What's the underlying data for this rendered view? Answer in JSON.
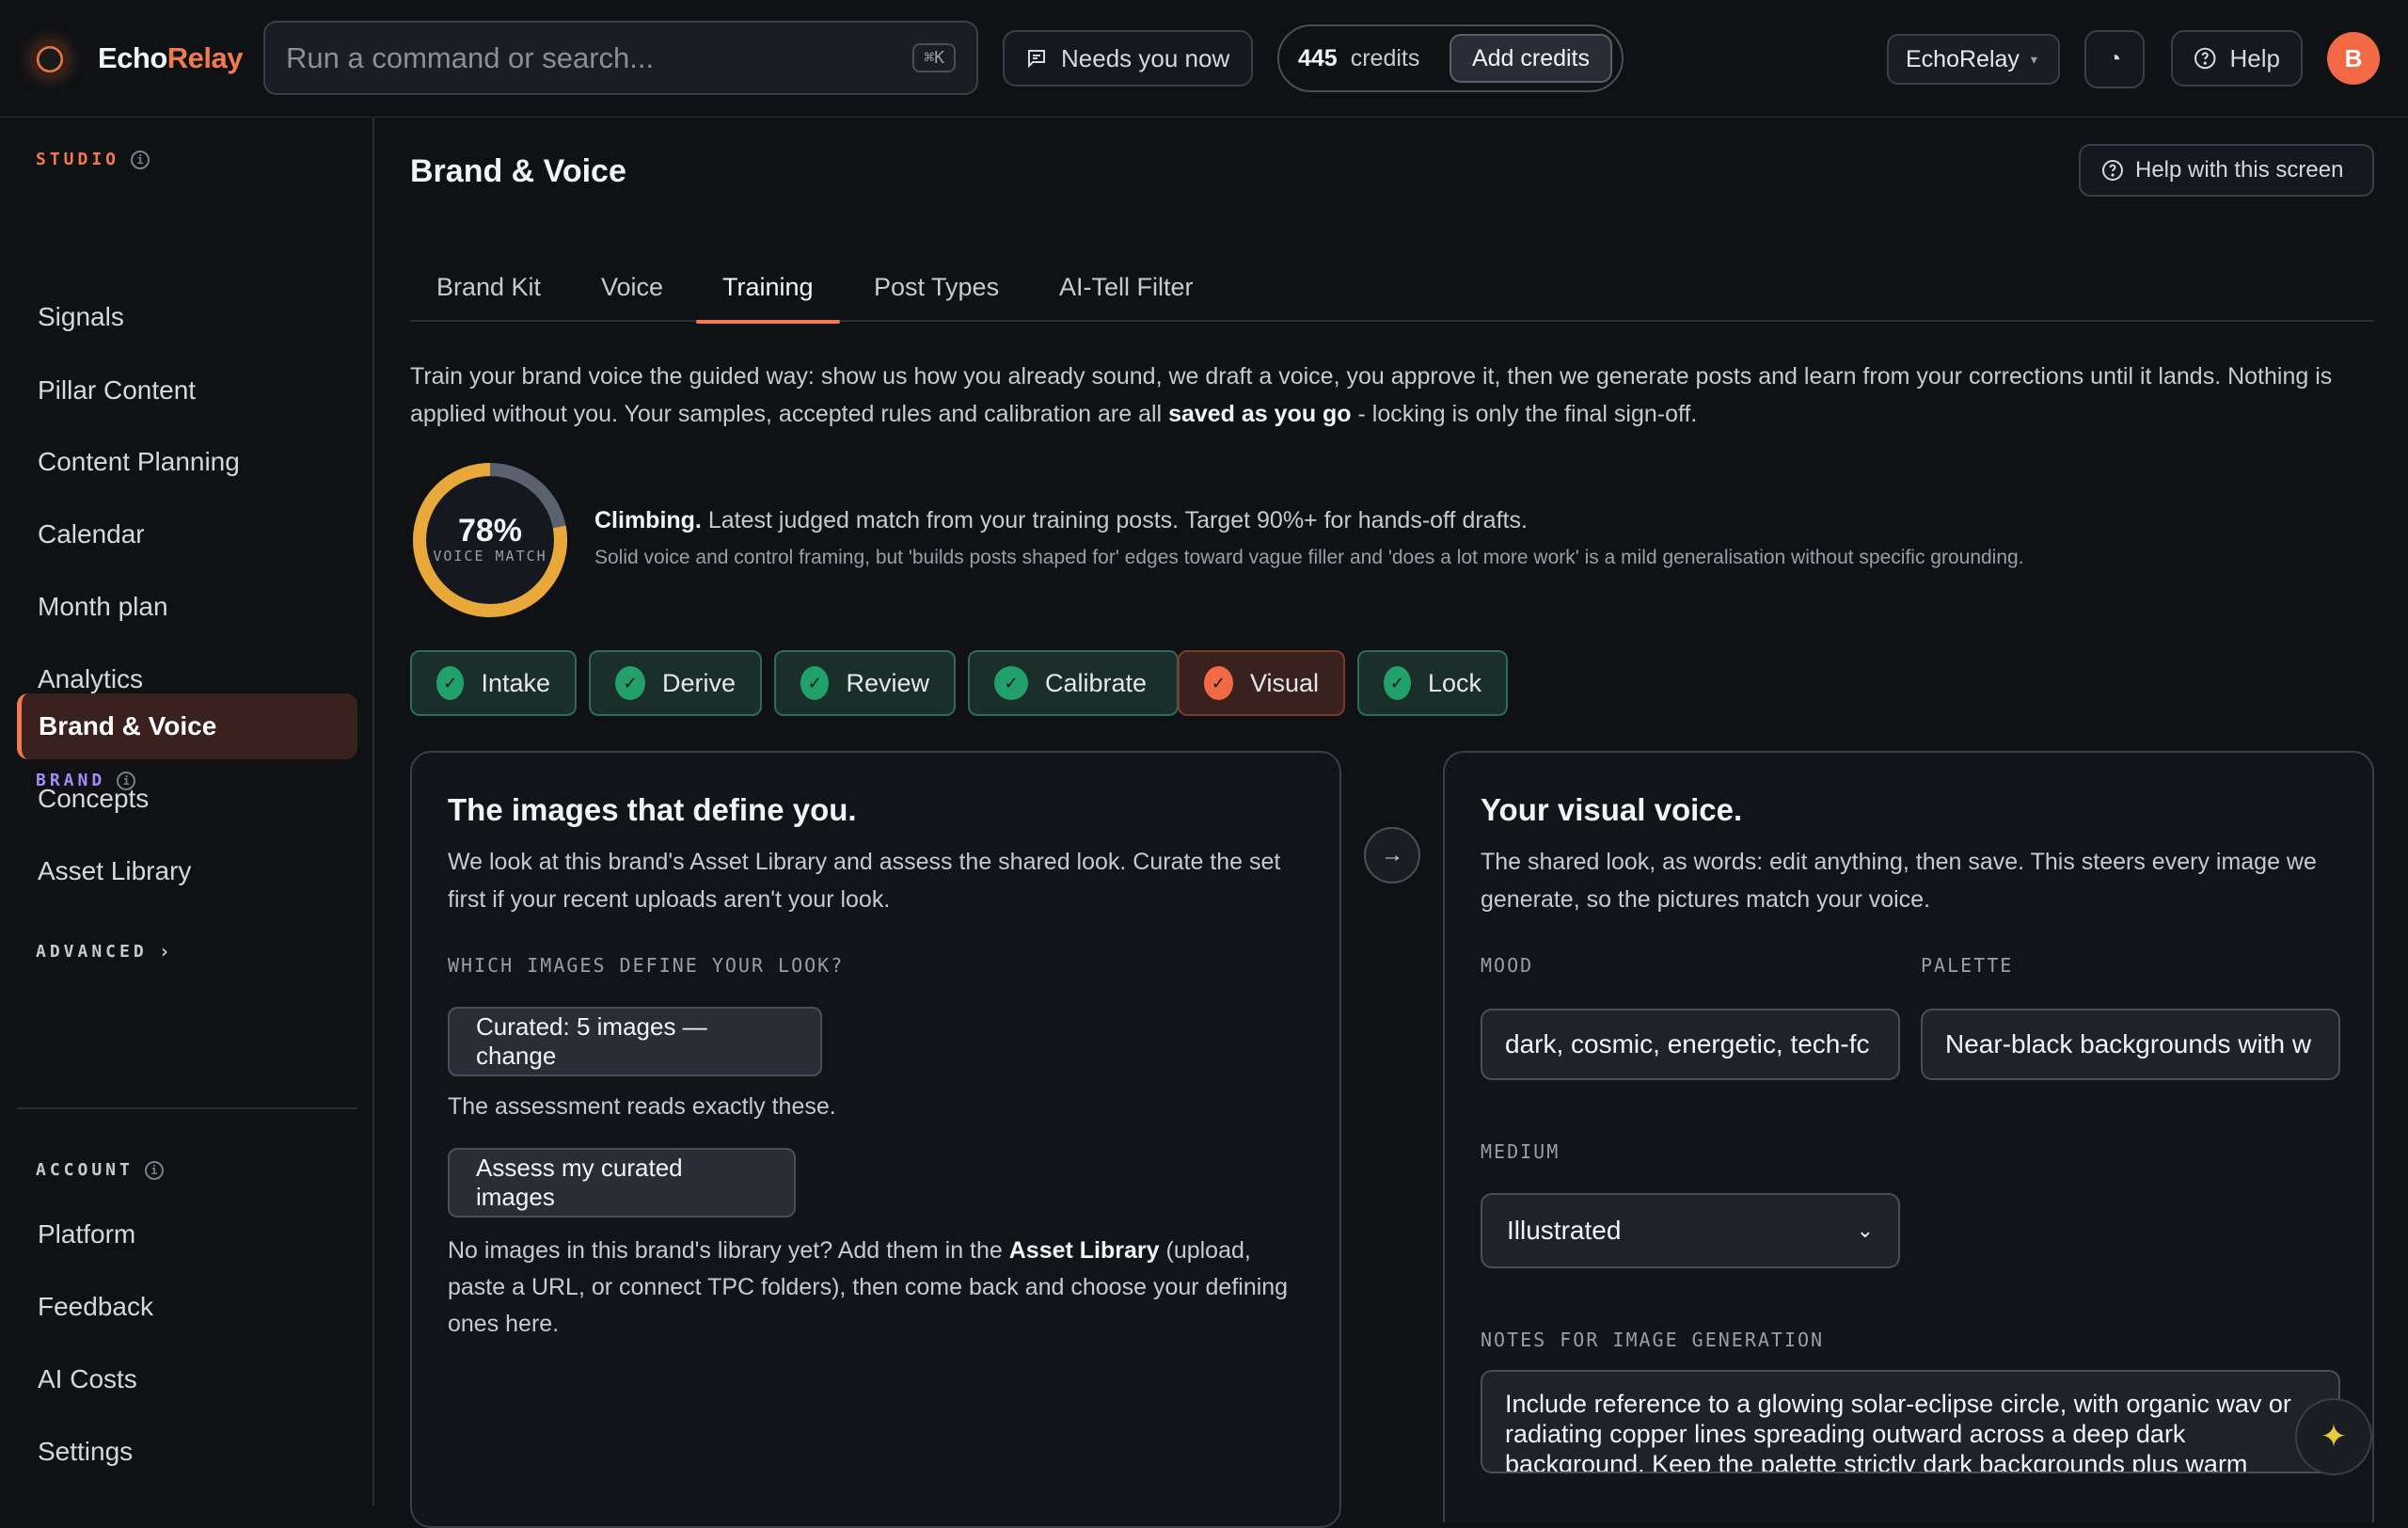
{
  "app": {
    "name_a": "Echo",
    "name_b": "Relay"
  },
  "search": {
    "placeholder": "Run a command or search...",
    "shortcut": "⌘K"
  },
  "topbar": {
    "needs_label": "Needs you now",
    "credits_value": "445",
    "credits_label": "credits",
    "add_credits": "Add credits",
    "brand": "EchoRelay",
    "help": "Help",
    "avatar_initial": "B"
  },
  "sidebar": {
    "studio_label": "STUDIO",
    "studio_items": [
      "Signals",
      "Pillar Content",
      "Content Planning",
      "Calendar",
      "Month plan",
      "Analytics"
    ],
    "brand_label": "BRAND",
    "brand_items": [
      "Brand & Voice",
      "Concepts",
      "Asset Library"
    ],
    "advanced_label": "ADVANCED",
    "account_label": "ACCOUNT",
    "account_items": [
      "Platform",
      "Feedback",
      "AI Costs",
      "Settings"
    ]
  },
  "page": {
    "title": "Brand & Voice",
    "help_screen": "Help with this screen",
    "tabs": [
      "Brand Kit",
      "Voice",
      "Training",
      "Post Types",
      "AI-Tell Filter"
    ],
    "intro_1": "Train your brand voice the guided way: show us how you already sound, we draft a voice, you approve it, then we generate posts and learn from your corrections until it lands. Nothing is applied without you. Your samples, accepted rules and calibration are all ",
    "intro_bold": "saved as you go",
    "intro_2": " - locking is only the final sign-off."
  },
  "voice_match": {
    "percent": 78,
    "percent_label": "78%",
    "label": "VOICE MATCH",
    "status_bold": "Climbing.",
    "status_text": " Latest judged match from your training posts. Target 90%+ for hands-off drafts.",
    "detail": "Solid voice and control framing, but 'builds posts shaped for' edges toward vague filler and 'does a lot more work' is a mild generalisation without specific grounding.",
    "colors": {
      "fill": "#e8a93a",
      "track": "#5a6270"
    }
  },
  "steps": [
    {
      "label": "Intake",
      "state": "done"
    },
    {
      "label": "Derive",
      "state": "done"
    },
    {
      "label": "Review",
      "state": "done"
    },
    {
      "label": "Calibrate",
      "state": "done"
    },
    {
      "label": "Visual",
      "state": "current"
    },
    {
      "label": "Lock",
      "state": "done"
    }
  ],
  "left_card": {
    "title": "The images that define you.",
    "desc": "We look at this brand's Asset Library and assess the shared look. Curate the set first if your recent uploads aren't your look.",
    "question": "WHICH IMAGES DEFINE YOUR LOOK?",
    "curated_button": "Curated: 5 images — change",
    "assessment_note": "The assessment reads exactly these.",
    "assess_button": "Assess my curated images",
    "empty_1": "No images in this brand's library yet? Add them in the ",
    "empty_bold": "Asset Library",
    "empty_2": " (upload, paste a URL, or connect TPC folders), then come back and choose your defining ones here."
  },
  "right_card": {
    "title": "Your visual voice.",
    "desc": "The shared look, as words: edit anything, then save. This steers every image we generate, so the pictures match your voice.",
    "mood_label": "MOOD",
    "mood_value": "dark, cosmic, energetic, tech-fc",
    "palette_label": "PALETTE",
    "palette_value": "Near-black backgrounds with w",
    "medium_label": "MEDIUM",
    "medium_value": "Illustrated",
    "notes_label": "NOTES FOR IMAGE GENERATION",
    "notes_value": "Include reference to a glowing solar-eclipse circle, with organic wav or radiating copper lines spreading outward across a deep dark background. Keep the palette strictly dark backgrounds plus warm"
  },
  "colors": {
    "accent": "#f27a4c",
    "success": "#22a06b",
    "bg": "#0f1115"
  }
}
